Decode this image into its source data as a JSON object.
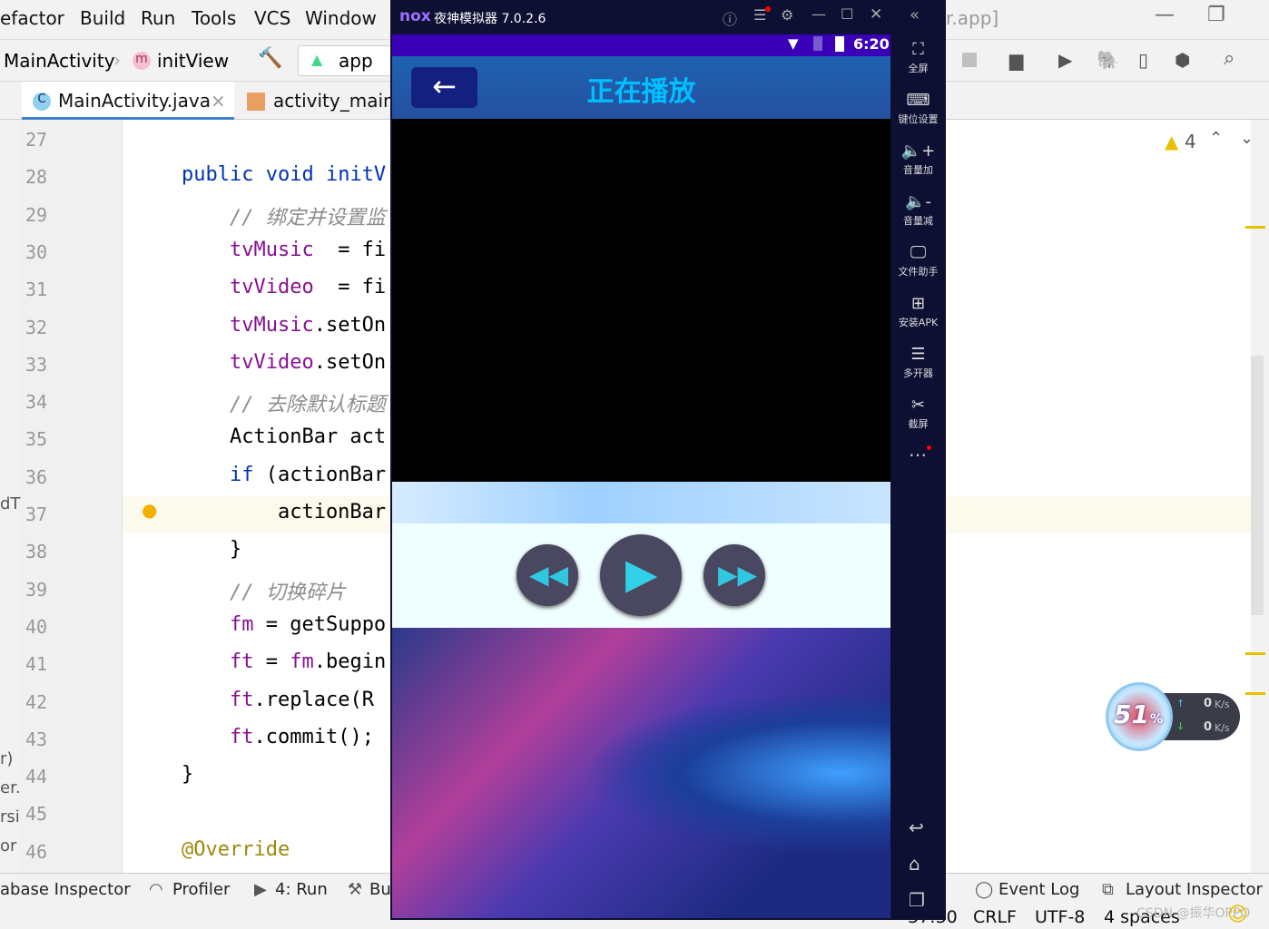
{
  "ide": {
    "menu": [
      "efactor",
      "Build",
      "Run",
      "Tools",
      "VCS",
      "Window"
    ],
    "window_title_fragment": "r.app]",
    "breadcrumb": [
      "MainActivity",
      "initView"
    ],
    "run_config": "app",
    "tabs": [
      {
        "label": "MainActivity.java",
        "icon": "C"
      },
      {
        "label": "activity_main."
      }
    ],
    "warnings": "4",
    "code": [
      {
        "n": "27",
        "t": []
      },
      {
        "n": "28",
        "t": [
          [
            "kw",
            "public void "
          ],
          [
            "kw",
            "initV"
          ]
        ]
      },
      {
        "n": "29",
        "t": [
          [
            "cm",
            "    // 绑定并设置监"
          ]
        ]
      },
      {
        "n": "30",
        "t": [
          [
            "fld",
            "    tvMusic"
          ],
          [
            "",
            "  = fi"
          ]
        ]
      },
      {
        "n": "31",
        "t": [
          [
            "fld",
            "    tvVideo"
          ],
          [
            "",
            "  = fi"
          ]
        ]
      },
      {
        "n": "32",
        "t": [
          [
            "fld",
            "    tvMusic"
          ],
          [
            "",
            ".setOn"
          ]
        ]
      },
      {
        "n": "33",
        "t": [
          [
            "fld",
            "    tvVideo"
          ],
          [
            "",
            ".setOn"
          ]
        ]
      },
      {
        "n": "34",
        "t": [
          [
            "cm",
            "    // 去除默认标题"
          ]
        ]
      },
      {
        "n": "35",
        "t": [
          [
            "",
            "    ActionBar act"
          ]
        ]
      },
      {
        "n": "36",
        "t": [
          [
            "kw",
            "    if "
          ],
          [
            "",
            "(actionBar"
          ]
        ]
      },
      {
        "n": "37",
        "t": [
          [
            "",
            "        actionBar"
          ]
        ]
      },
      {
        "n": "38",
        "t": [
          [
            "",
            "    }"
          ]
        ]
      },
      {
        "n": "39",
        "t": [
          [
            "cm",
            "    // 切换碎片"
          ]
        ]
      },
      {
        "n": "40",
        "t": [
          [
            "fld",
            "    fm"
          ],
          [
            "",
            " = getSuppo"
          ]
        ]
      },
      {
        "n": "41",
        "t": [
          [
            "fld",
            "    ft"
          ],
          [
            "",
            " = "
          ],
          [
            "fld",
            "fm"
          ],
          [
            "",
            ".begin"
          ]
        ]
      },
      {
        "n": "42",
        "t": [
          [
            "fld",
            "    ft"
          ],
          [
            "",
            ".replace(R"
          ]
        ]
      },
      {
        "n": "43",
        "t": [
          [
            "fld",
            "    ft"
          ],
          [
            "",
            ".commit();"
          ]
        ]
      },
      {
        "n": "44",
        "t": [
          [
            "",
            "}"
          ]
        ]
      },
      {
        "n": "45",
        "t": []
      },
      {
        "n": "46",
        "t": [
          [
            "ann",
            "@Override"
          ]
        ]
      }
    ],
    "bottom_tools": [
      "abase Inspector",
      "Profiler",
      "4: Run",
      "Bu",
      "Event Log",
      "Layout Inspector"
    ],
    "status": [
      "37:30",
      "CRLF",
      "UTF-8",
      "4 spaces"
    ],
    "watermark": "CSDN @振华OPPO",
    "left_edge_fragments": [
      "dT",
      "r)",
      "er.",
      "rsi",
      "or"
    ]
  },
  "emulator": {
    "title": "夜神模拟器 7.0.2.6",
    "logo": "nox",
    "time": "6:20",
    "app_title": "正在播放",
    "sidebar": [
      {
        "icon": "fullscreen-icon",
        "g": "⛶",
        "label": "全屏"
      },
      {
        "icon": "keyboard-icon",
        "g": "⌨",
        "label": "键位设置"
      },
      {
        "icon": "volume-up-icon",
        "g": "🔈+",
        "label": "音量加"
      },
      {
        "icon": "volume-down-icon",
        "g": "🔈-",
        "label": "音量减"
      },
      {
        "icon": "file-icon",
        "g": "🖵",
        "label": "文件助手"
      },
      {
        "icon": "apk-icon",
        "g": "⊞",
        "label": "安装APK"
      },
      {
        "icon": "multi-icon",
        "g": "☰",
        "label": "多开器"
      },
      {
        "icon": "scissors-icon",
        "g": "✂",
        "label": "截屏"
      }
    ]
  },
  "network": {
    "percent": "51",
    "unit": "%",
    "up": "0",
    "down": "0",
    "rate_unit": "K/s"
  }
}
